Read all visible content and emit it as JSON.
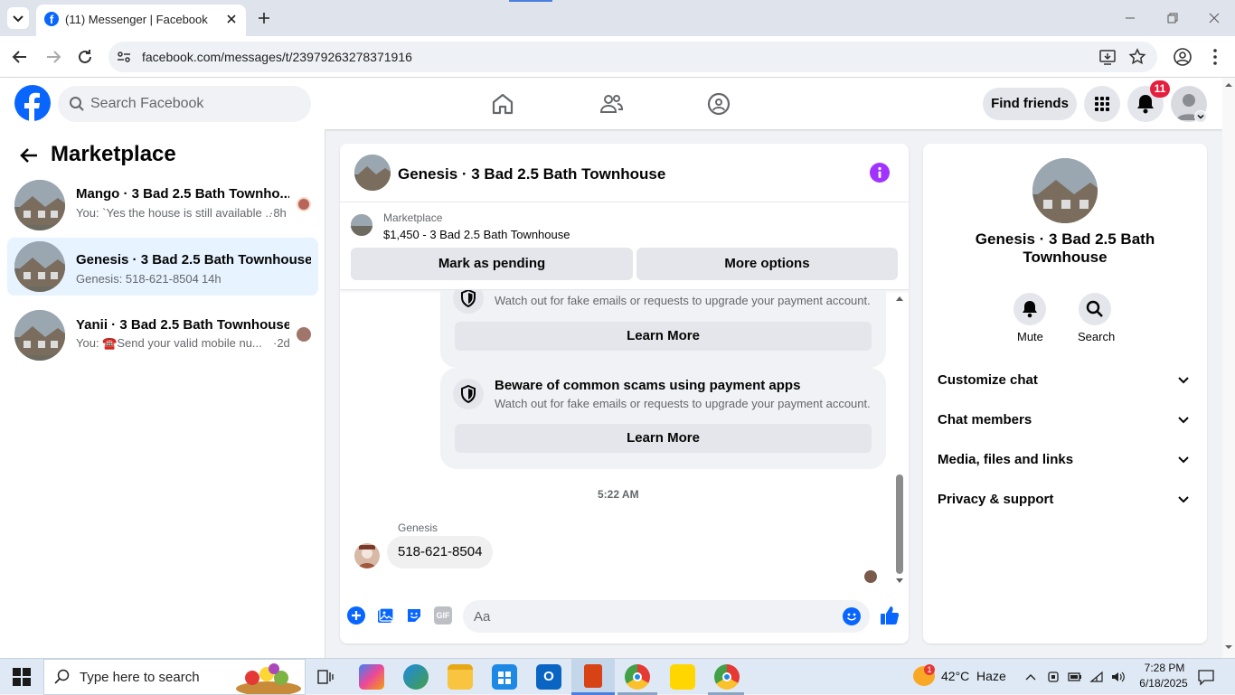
{
  "browser": {
    "tab_title": "(11) Messenger | Facebook",
    "url": "facebook.com/messages/t/23979263278371916"
  },
  "fb_header": {
    "search_placeholder": "Search Facebook",
    "find_friends": "Find friends",
    "notification_count": "11"
  },
  "left_panel": {
    "title": "Marketplace",
    "conversations": [
      {
        "title": "Mango · 3 Bad 2.5 Bath Townho...",
        "preview": "You: `Yes the house is still available ...",
        "time": "·8h",
        "selected": false
      },
      {
        "title": "Genesis · 3 Bad 2.5 Bath Townhouse",
        "preview": "Genesis: 518-621-8504",
        "time": "· 14h",
        "selected": true
      },
      {
        "title": "Yanii · 3 Bad 2.5 Bath Townhouse",
        "preview": "You: ☎️Send your valid mobile nu...",
        "time": "·2d",
        "selected": false
      }
    ]
  },
  "chat": {
    "title": "Genesis · 3 Bad 2.5 Bath Townhouse",
    "listing_label": "Marketplace",
    "listing_detail": "$1,450 - 3 Bad 2.5 Bath Townhouse",
    "mark_pending": "Mark as pending",
    "more_options": "More options",
    "card1_text": "Watch out for fake emails or requests to upgrade your payment account.",
    "card1_button": "Learn More",
    "card2_title": "Beware of common scams using payment apps",
    "card2_text": "Watch out for fake emails or requests to upgrade your payment account.",
    "card2_button": "Learn More",
    "timestamp": "5:22 AM",
    "sender": "Genesis",
    "message": "518-621-8504",
    "input_placeholder": "Aa",
    "colors": {
      "accent": "#0866ff",
      "info": "#a033ff"
    }
  },
  "right_panel": {
    "title": "Genesis · 3 Bad 2.5 Bath Townhouse",
    "mute": "Mute",
    "search": "Search",
    "sections": [
      "Customize chat",
      "Chat members",
      "Media, files and links",
      "Privacy & support"
    ]
  },
  "taskbar": {
    "search_placeholder": "Type here to search",
    "weather": "42°C  Haze",
    "time": "7:28 PM",
    "date": "6/18/2025",
    "weather_badge": "1"
  }
}
